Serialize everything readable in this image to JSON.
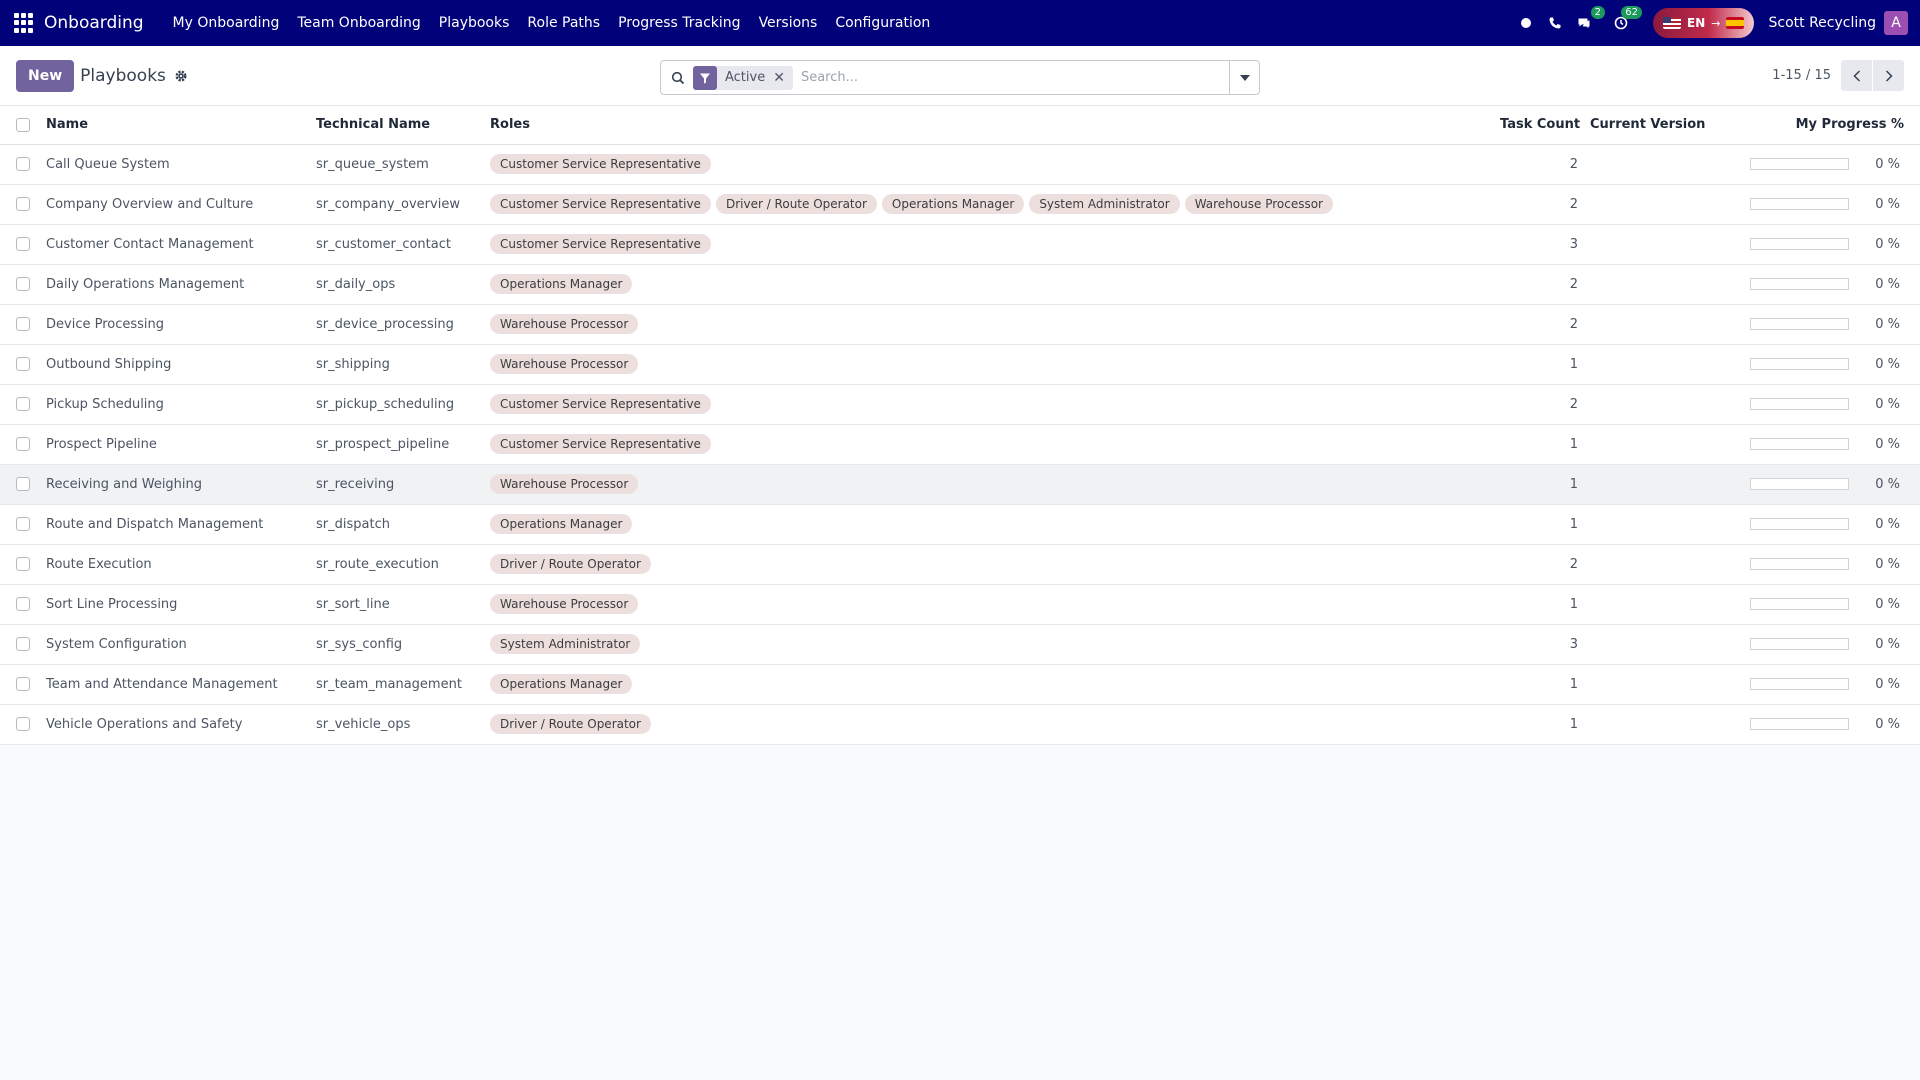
{
  "navbar": {
    "brand": "Onboarding",
    "menu": [
      "My Onboarding",
      "Team Onboarding",
      "Playbooks",
      "Role Paths",
      "Progress Tracking",
      "Versions",
      "Configuration"
    ],
    "messages_badge": "2",
    "activities_badge": "62",
    "lang_code": "EN",
    "lang_arrow": "→",
    "company": "Scott Recycling",
    "avatar_initial": "A"
  },
  "control_panel": {
    "new_label": "New",
    "title": "Playbooks",
    "facet_label": "Active",
    "search_placeholder": "Search...",
    "pager": "1-15 / 15"
  },
  "table": {
    "headers": {
      "name": "Name",
      "technical": "Technical Name",
      "roles": "Roles",
      "count": "Task Count",
      "version": "Current Version",
      "progress": "My Progress %"
    },
    "rows": [
      {
        "name": "Call Queue System",
        "technical": "sr_queue_system",
        "roles": [
          "Customer Service Representative"
        ],
        "count": "2",
        "version": "",
        "progress_value": 0,
        "progress_text": "0 %"
      },
      {
        "name": "Company Overview and Culture",
        "technical": "sr_company_overview",
        "roles": [
          "Customer Service Representative",
          "Driver / Route Operator",
          "Operations Manager",
          "System Administrator",
          "Warehouse Processor"
        ],
        "count": "2",
        "version": "",
        "progress_value": 0,
        "progress_text": "0 %"
      },
      {
        "name": "Customer Contact Management",
        "technical": "sr_customer_contact",
        "roles": [
          "Customer Service Representative"
        ],
        "count": "3",
        "version": "",
        "progress_value": 0,
        "progress_text": "0 %"
      },
      {
        "name": "Daily Operations Management",
        "technical": "sr_daily_ops",
        "roles": [
          "Operations Manager"
        ],
        "count": "2",
        "version": "",
        "progress_value": 0,
        "progress_text": "0 %"
      },
      {
        "name": "Device Processing",
        "technical": "sr_device_processing",
        "roles": [
          "Warehouse Processor"
        ],
        "count": "2",
        "version": "",
        "progress_value": 0,
        "progress_text": "0 %"
      },
      {
        "name": "Outbound Shipping",
        "technical": "sr_shipping",
        "roles": [
          "Warehouse Processor"
        ],
        "count": "1",
        "version": "",
        "progress_value": 0,
        "progress_text": "0 %"
      },
      {
        "name": "Pickup Scheduling",
        "technical": "sr_pickup_scheduling",
        "roles": [
          "Customer Service Representative"
        ],
        "count": "2",
        "version": "",
        "progress_value": 0,
        "progress_text": "0 %"
      },
      {
        "name": "Prospect Pipeline",
        "technical": "sr_prospect_pipeline",
        "roles": [
          "Customer Service Representative"
        ],
        "count": "1",
        "version": "",
        "progress_value": 0,
        "progress_text": "0 %"
      },
      {
        "name": "Receiving and Weighing",
        "technical": "sr_receiving",
        "roles": [
          "Warehouse Processor"
        ],
        "count": "1",
        "version": "",
        "progress_value": 0,
        "progress_text": "0 %"
      },
      {
        "name": "Route and Dispatch Management",
        "technical": "sr_dispatch",
        "roles": [
          "Operations Manager"
        ],
        "count": "1",
        "version": "",
        "progress_value": 0,
        "progress_text": "0 %"
      },
      {
        "name": "Route Execution",
        "technical": "sr_route_execution",
        "roles": [
          "Driver / Route Operator"
        ],
        "count": "2",
        "version": "",
        "progress_value": 0,
        "progress_text": "0 %"
      },
      {
        "name": "Sort Line Processing",
        "technical": "sr_sort_line",
        "roles": [
          "Warehouse Processor"
        ],
        "count": "1",
        "version": "",
        "progress_value": 0,
        "progress_text": "0 %"
      },
      {
        "name": "System Configuration",
        "technical": "sr_sys_config",
        "roles": [
          "System Administrator"
        ],
        "count": "3",
        "version": "",
        "progress_value": 0,
        "progress_text": "0 %"
      },
      {
        "name": "Team and Attendance Management",
        "technical": "sr_team_management",
        "roles": [
          "Operations Manager"
        ],
        "count": "1",
        "version": "",
        "progress_value": 0,
        "progress_text": "0 %"
      },
      {
        "name": "Vehicle Operations and Safety",
        "technical": "sr_vehicle_ops",
        "roles": [
          "Driver / Route Operator"
        ],
        "count": "1",
        "version": "",
        "progress_value": 0,
        "progress_text": "0 %"
      }
    ]
  },
  "colors": {
    "navbar": "#01017a",
    "primary": "#71639e",
    "tag_bg": "#ecdfdd",
    "badge": "#1a9a5c"
  }
}
